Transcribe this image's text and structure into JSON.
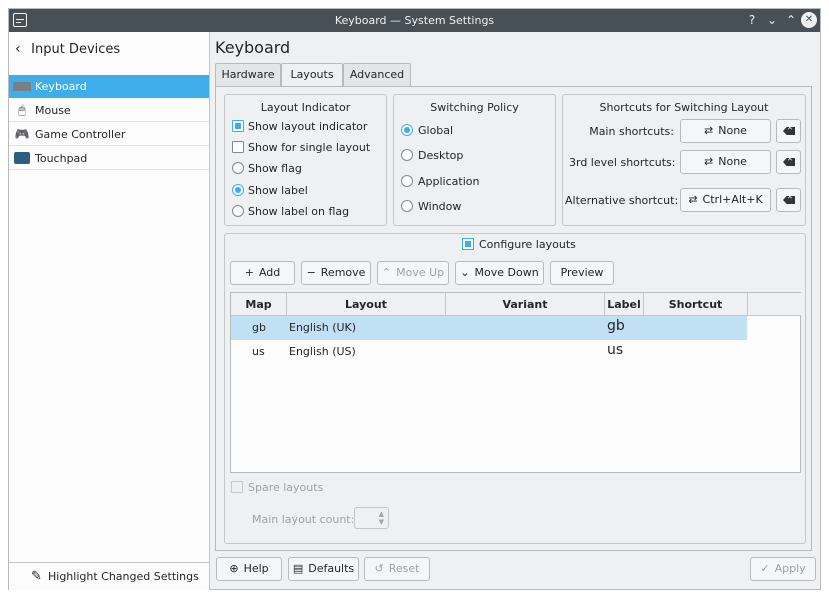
{
  "window": {
    "title": "Keyboard — System Settings"
  },
  "titlebar": {
    "help_glyph": "?",
    "min_glyph": "⌄",
    "max_glyph": "⌃",
    "close_glyph": "✕"
  },
  "sidebar": {
    "back_label": "Input Devices",
    "items": [
      {
        "label": "Keyboard",
        "icon": "keyboard-icon",
        "selected": true
      },
      {
        "label": "Mouse",
        "icon": "mouse-icon"
      },
      {
        "label": "Game Controller",
        "icon": "gamepad-icon"
      },
      {
        "label": "Touchpad",
        "icon": "touchpad-icon"
      }
    ],
    "highlight_label": "Highlight Changed Settings"
  },
  "main": {
    "title": "Keyboard",
    "tabs": [
      {
        "label": "Hardware"
      },
      {
        "label": "Layouts",
        "active": true
      },
      {
        "label": "Advanced"
      }
    ]
  },
  "layout_indicator": {
    "title": "Layout Indicator",
    "show_layout_indicator": "Show layout indicator",
    "show_for_single": "Show for single layout",
    "show_flag": "Show flag",
    "show_label": "Show label",
    "show_label_on_flag": "Show label on flag",
    "selected": "Show label"
  },
  "switching_policy": {
    "title": "Switching Policy",
    "options": [
      "Global",
      "Desktop",
      "Application",
      "Window"
    ],
    "selected": "Global"
  },
  "shortcuts": {
    "title": "Shortcuts for Switching Layout",
    "main_label": "Main shortcuts:",
    "main_value": "None",
    "third_label": "3rd level shortcuts:",
    "third_value": "None",
    "alt_label": "Alternative shortcut:",
    "alt_value": "Ctrl+Alt+K"
  },
  "configure": {
    "label": "Configure layouts",
    "checked": true,
    "buttons": {
      "add": "Add",
      "remove": "Remove",
      "move_up": "Move Up",
      "move_down": "Move Down",
      "preview": "Preview"
    },
    "columns": [
      "Map",
      "Layout",
      "Variant",
      "Label",
      "Shortcut"
    ],
    "rows": [
      {
        "map": "gb",
        "layout": "English (UK)",
        "variant": "",
        "label": "gb",
        "shortcut": ""
      },
      {
        "map": "us",
        "layout": "English (US)",
        "variant": "",
        "label": "us",
        "shortcut": ""
      }
    ],
    "spare_layouts": "Spare layouts",
    "main_layout_count": "Main layout count:"
  },
  "footer": {
    "help": "Help",
    "defaults": "Defaults",
    "reset": "Reset",
    "apply": "Apply"
  },
  "colors": {
    "accent": "#3daee9",
    "titlebar": "#475057",
    "selection": "#c1e0f4"
  }
}
